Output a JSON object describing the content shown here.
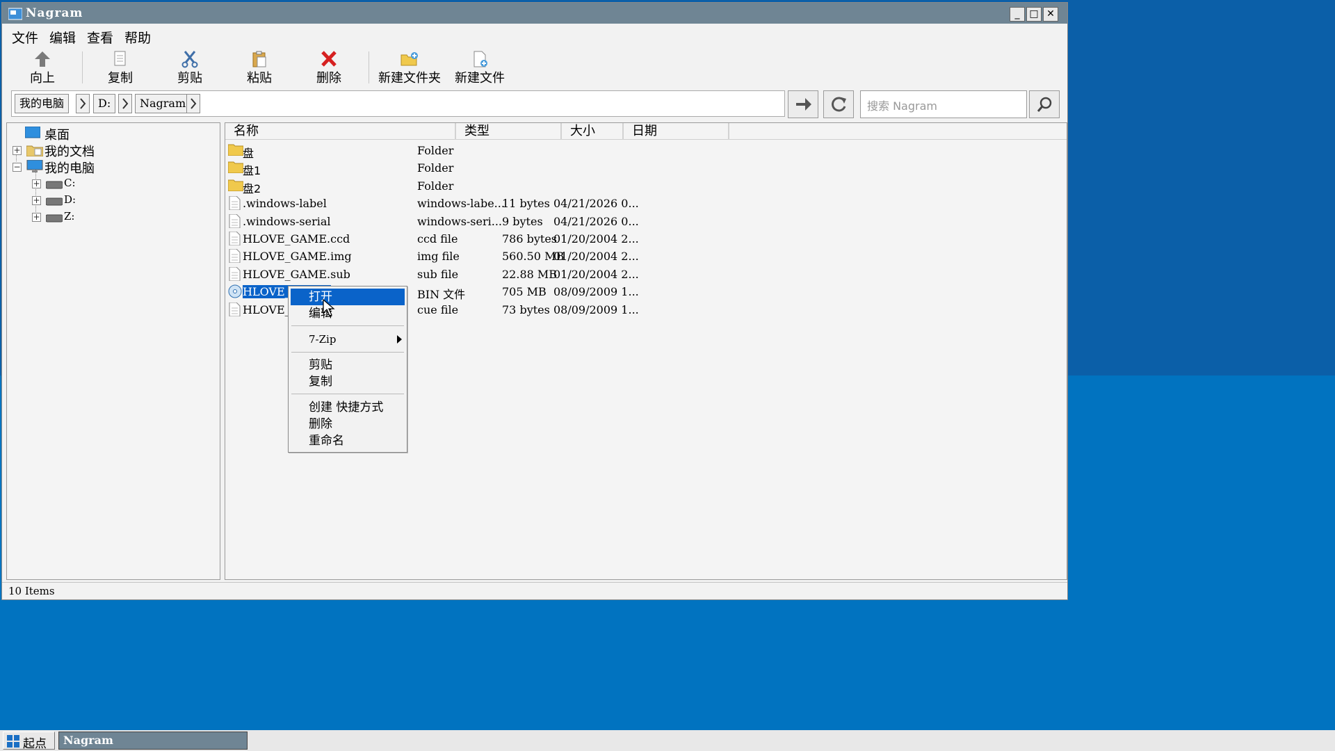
{
  "window": {
    "title": "Nagram",
    "controls": {
      "minimize": "_",
      "maximize": "□",
      "close": "✕"
    }
  },
  "menubar": [
    "文件",
    "编辑",
    "查看",
    "帮助"
  ],
  "toolbar": {
    "up": "向上",
    "copy": "复制",
    "cut": "剪贴",
    "paste": "粘贴",
    "delete": "删除",
    "new_folder": "新建文件夹",
    "new_file": "新建文件"
  },
  "address": {
    "crumbs": [
      "我的电脑",
      "D:",
      "Nagram"
    ]
  },
  "search": {
    "placeholder": "搜索 Nagram"
  },
  "tree": {
    "items": [
      {
        "label": "桌面",
        "icon": "desktop-icon"
      },
      {
        "label": "我的文档",
        "icon": "documents-icon"
      },
      {
        "label": "我的电脑",
        "icon": "computer-icon"
      },
      {
        "label": "C:",
        "icon": "drive-icon"
      },
      {
        "label": "D:",
        "icon": "drive-icon"
      },
      {
        "label": "Z:",
        "icon": "drive-icon"
      }
    ]
  },
  "columns": [
    "名称",
    "类型",
    "大小",
    "日期"
  ],
  "files": [
    {
      "name": "盘",
      "type": "Folder",
      "size": "",
      "date": "",
      "icon": "folder-icon"
    },
    {
      "name": "盘1",
      "type": "Folder",
      "size": "",
      "date": "",
      "icon": "folder-icon"
    },
    {
      "name": "盘2",
      "type": "Folder",
      "size": "",
      "date": "",
      "icon": "folder-icon"
    },
    {
      "name": ".windows-label",
      "type": "windows-labe...",
      "size": "11 bytes",
      "date": "04/21/2026 0...",
      "icon": "file-icon"
    },
    {
      "name": ".windows-serial",
      "type": "windows-seri...",
      "size": "9 bytes",
      "date": "04/21/2026 0...",
      "icon": "file-icon"
    },
    {
      "name": "HLOVE_GAME.ccd",
      "type": "ccd file",
      "size": "786 bytes",
      "date": "01/20/2004 2...",
      "icon": "file-icon"
    },
    {
      "name": "HLOVE_GAME.img",
      "type": "img file",
      "size": "560.50 MB",
      "date": "01/20/2004 2...",
      "icon": "file-icon"
    },
    {
      "name": "HLOVE_GAME.sub",
      "type": "sub file",
      "size": "22.88 MB",
      "date": "01/20/2004 2...",
      "icon": "file-icon"
    },
    {
      "name": "HLOVE_I",
      "type": "BIN 文件",
      "size": "705 MB",
      "date": "08/09/2009 1...",
      "icon": "disc-icon"
    },
    {
      "name": "HLOVE_I",
      "type": "cue file",
      "size": "73 bytes",
      "date": "08/09/2009 1...",
      "icon": "file-icon"
    }
  ],
  "context_menu": {
    "open": "打开",
    "edit": "编辑",
    "zip": "7-Zip",
    "cut": "剪贴",
    "copy": "复制",
    "shortcut": "创建 快捷方式",
    "delete": "删除",
    "rename": "重命名"
  },
  "status": "10 Items",
  "taskbar": {
    "start": "起点",
    "task": "Nagram"
  },
  "colors": {
    "titlebar": "#6f8594",
    "selection": "#0a63c9",
    "desktop": "#0173c0"
  }
}
